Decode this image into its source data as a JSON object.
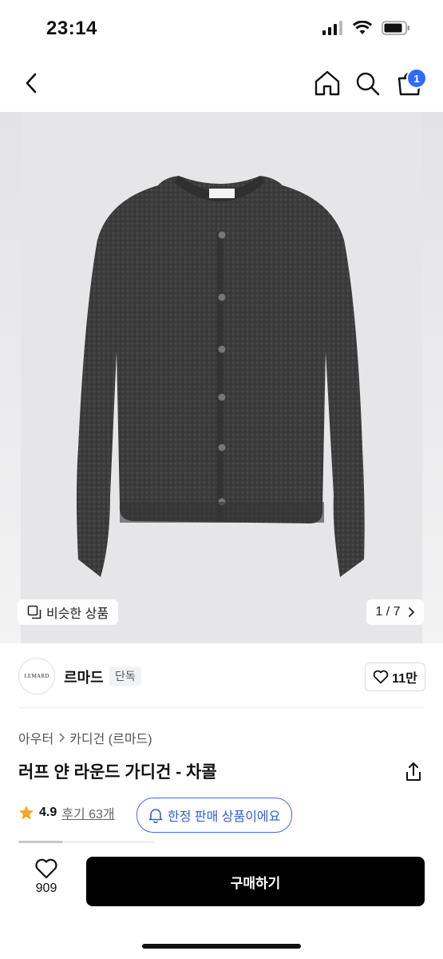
{
  "status": {
    "time": "23:14"
  },
  "nav": {
    "cart_count": "1"
  },
  "gallery": {
    "similar_label": "비슷한 상품",
    "pager": "1 / 7"
  },
  "brand": {
    "logo_text": "LEMARD",
    "name": "르마드",
    "tag": "단독",
    "likes": "11만"
  },
  "product": {
    "breadcrumb": [
      "아우터",
      "카디건 (르마드)"
    ],
    "title": "러프 얀 라운드 가디건 - 차콜",
    "rating": "4.9",
    "reviews": "후기 63개",
    "limited_label": "한정 판매 상품이에요"
  },
  "bottom": {
    "heart_count": "909",
    "buy_label": "구매하기"
  },
  "colors": {
    "accent": "#2f6bff",
    "buy_bg": "#000000",
    "star": "#f5a623"
  },
  "icons": [
    "back-icon",
    "home-icon",
    "search-icon",
    "cart-icon",
    "copy-icon",
    "chevron-right-icon",
    "heart-icon",
    "share-icon",
    "star-icon",
    "bell-icon"
  ]
}
